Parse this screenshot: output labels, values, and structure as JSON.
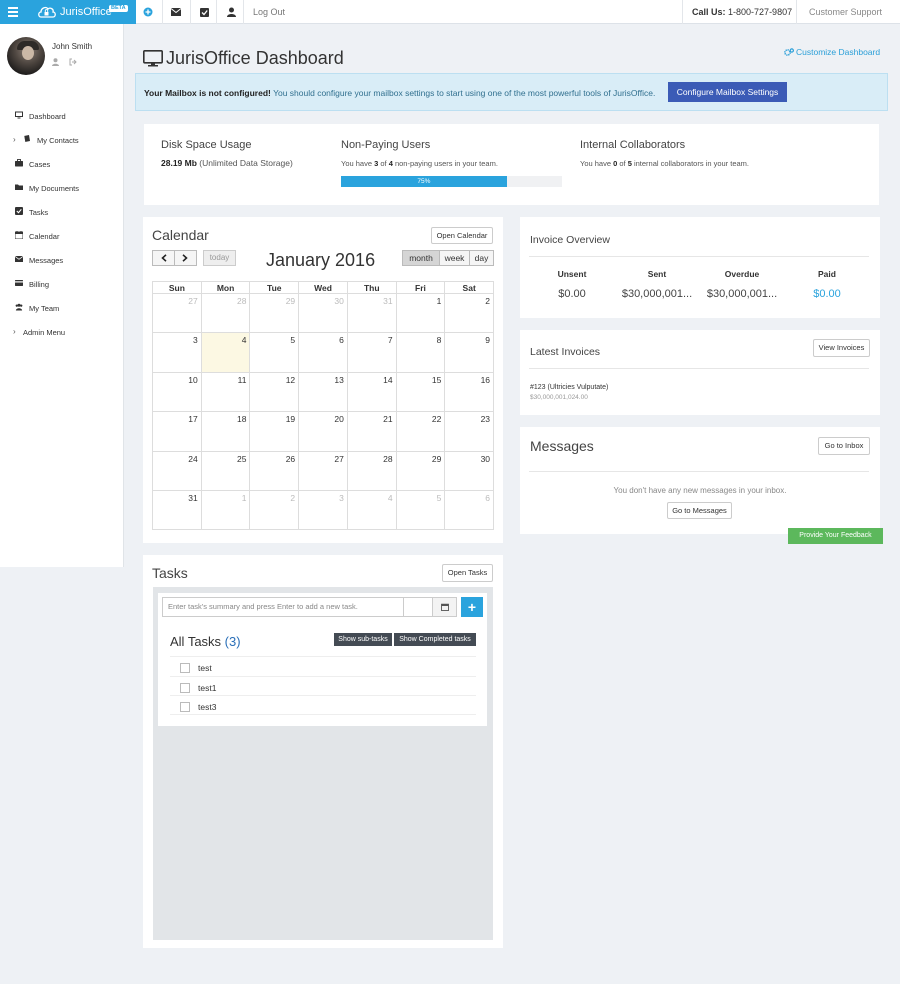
{
  "topbar": {
    "brand_name": "JurisOffice",
    "brand_badge": "BETA",
    "logout": "Log Out",
    "call_label": "Call Us:",
    "call_number": "1-800-727-9807",
    "support": "Customer Support",
    "brand_color": "#2aa3dd"
  },
  "user": {
    "name": "John Smith"
  },
  "sidebar": {
    "items": [
      {
        "label": "Dashboard",
        "icon": "monitor-icon"
      },
      {
        "label": "My Contacts",
        "icon": "book-icon"
      },
      {
        "label": "Cases",
        "icon": "briefcase-icon"
      },
      {
        "label": "My Documents",
        "icon": "folder-icon"
      },
      {
        "label": "Tasks",
        "icon": "check-square-icon"
      },
      {
        "label": "Calendar",
        "icon": "calendar-icon"
      },
      {
        "label": "Messages",
        "icon": "envelope-icon"
      },
      {
        "label": "Billing",
        "icon": "credit-card-icon"
      },
      {
        "label": "My Team",
        "icon": "users-icon"
      },
      {
        "label": "Admin Menu",
        "icon": "chevron-right-icon"
      }
    ]
  },
  "header": {
    "title": "JurisOffice Dashboard",
    "customize": "Customize Dashboard"
  },
  "alert": {
    "bold": "Your Mailbox is not configured!",
    "text": " You should configure your mailbox settings to start using one of the most powerful tools of JurisOffice.",
    "button": "Configure Mailbox Settings"
  },
  "stats": {
    "disk_title": "Disk Space Usage",
    "disk_value": "28.19 Mb",
    "disk_note": " (Unlimited Data Storage)",
    "nonpaying_title": "Non-Paying Users",
    "nonpaying_pre": "You have ",
    "nonpaying_a": "3",
    "nonpaying_mid": " of ",
    "nonpaying_b": "4",
    "nonpaying_post": " non-paying users in your team.",
    "progress_label": "75%",
    "progress_value": 0.75,
    "internal_title": "Internal Collaborators",
    "internal_pre": "You have ",
    "internal_a": "0",
    "internal_mid": " of ",
    "internal_b": "5",
    "internal_post": " internal collaborators in your team."
  },
  "calendar": {
    "title": "Calendar",
    "open_button": "Open Calendar",
    "today": "today",
    "month_label": "January 2016",
    "views": [
      "month",
      "week",
      "day"
    ],
    "days": [
      "Sun",
      "Mon",
      "Tue",
      "Wed",
      "Thu",
      "Fri",
      "Sat"
    ],
    "weeks": [
      [
        [
          "27",
          1
        ],
        [
          "28",
          1
        ],
        [
          "29",
          1
        ],
        [
          "30",
          1
        ],
        [
          "31",
          1
        ],
        [
          "1",
          0
        ],
        [
          "2",
          0
        ]
      ],
      [
        [
          "3",
          0
        ],
        [
          "4",
          0
        ],
        [
          "5",
          0
        ],
        [
          "6",
          0
        ],
        [
          "7",
          0
        ],
        [
          "8",
          0
        ],
        [
          "9",
          0
        ]
      ],
      [
        [
          "10",
          0
        ],
        [
          "11",
          0
        ],
        [
          "12",
          0
        ],
        [
          "13",
          0
        ],
        [
          "14",
          0
        ],
        [
          "15",
          0
        ],
        [
          "16",
          0
        ]
      ],
      [
        [
          "17",
          0
        ],
        [
          "18",
          0
        ],
        [
          "19",
          0
        ],
        [
          "20",
          0
        ],
        [
          "21",
          0
        ],
        [
          "22",
          0
        ],
        [
          "23",
          0
        ]
      ],
      [
        [
          "24",
          0
        ],
        [
          "25",
          0
        ],
        [
          "26",
          0
        ],
        [
          "27",
          0
        ],
        [
          "28",
          0
        ],
        [
          "29",
          0
        ],
        [
          "30",
          0
        ]
      ],
      [
        [
          "31",
          0
        ],
        [
          "1",
          1
        ],
        [
          "2",
          1
        ],
        [
          "3",
          1
        ],
        [
          "4",
          1
        ],
        [
          "5",
          1
        ],
        [
          "6",
          1
        ]
      ]
    ]
  },
  "tasks": {
    "title": "Tasks",
    "open_button": "Open Tasks",
    "placeholder": "Enter task's summary and press Enter to add a new task.",
    "add": "+",
    "all_label": "All Tasks ",
    "count": "(3)",
    "subtasks_btn": "Show sub-tasks",
    "completed_btn": "Show Completed tasks",
    "items": [
      "test",
      "test1",
      "test3"
    ]
  },
  "invoice_overview": {
    "title": "Invoice Overview",
    "headers": [
      "Unsent",
      "Sent",
      "Overdue",
      "Paid"
    ],
    "values": [
      "$0.00",
      "$30,000,001...",
      "$30,000,001...",
      "$0.00"
    ]
  },
  "latest_invoices": {
    "title": "Latest Invoices",
    "button": "View Invoices",
    "item_title": "#123 (Ultricies Vulputate)",
    "item_amount": "$30,000,001,024.00"
  },
  "messages": {
    "title": "Messages",
    "button": "Go to Inbox",
    "empty": "You don't have any new messages in your inbox.",
    "go_button": "Go to Messages"
  },
  "feedback": "Provide Your Feedback"
}
